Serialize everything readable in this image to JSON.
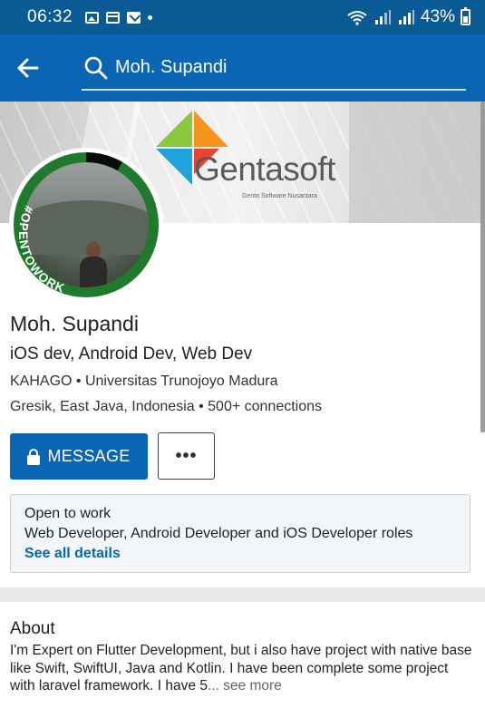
{
  "status_bar": {
    "time": "06:32",
    "battery": "43%"
  },
  "search": {
    "query": "Moh. Supandi"
  },
  "cover": {
    "logo_name": "Gentasoft",
    "logo_tagline": "Genta Software Nusantara",
    "logo_colors": [
      "#e8452c",
      "#f7941d",
      "#8dc63f",
      "#1ea3dc"
    ]
  },
  "profile": {
    "badge_text": "#OPENTOWORK",
    "name": "Moh. Supandi",
    "headline": "iOS dev, Android Dev, Web Dev",
    "company_education": "KAHAGO • Universitas Trunojoyo Madura",
    "location_connections": "Gresik, East Java, Indonesia • 500+ connections"
  },
  "actions": {
    "message_label": "MESSAGE",
    "more_label": "•••"
  },
  "open_to_work": {
    "title": "Open to work",
    "roles": "Web Developer, Android Developer and iOS Developer roles",
    "link": "See all details"
  },
  "about": {
    "title": "About",
    "text": "I'm Expert on Flutter Development, but i also have project with native base like Swift, SwiftUI, Java and Kotlin. I have been complete some project with laravel framework. I have 5",
    "see_more": "... see more"
  },
  "colors": {
    "brand": "#0a66b5",
    "status_bar": "#0a5a96",
    "open_to_work_green": "#1f7a2c"
  }
}
